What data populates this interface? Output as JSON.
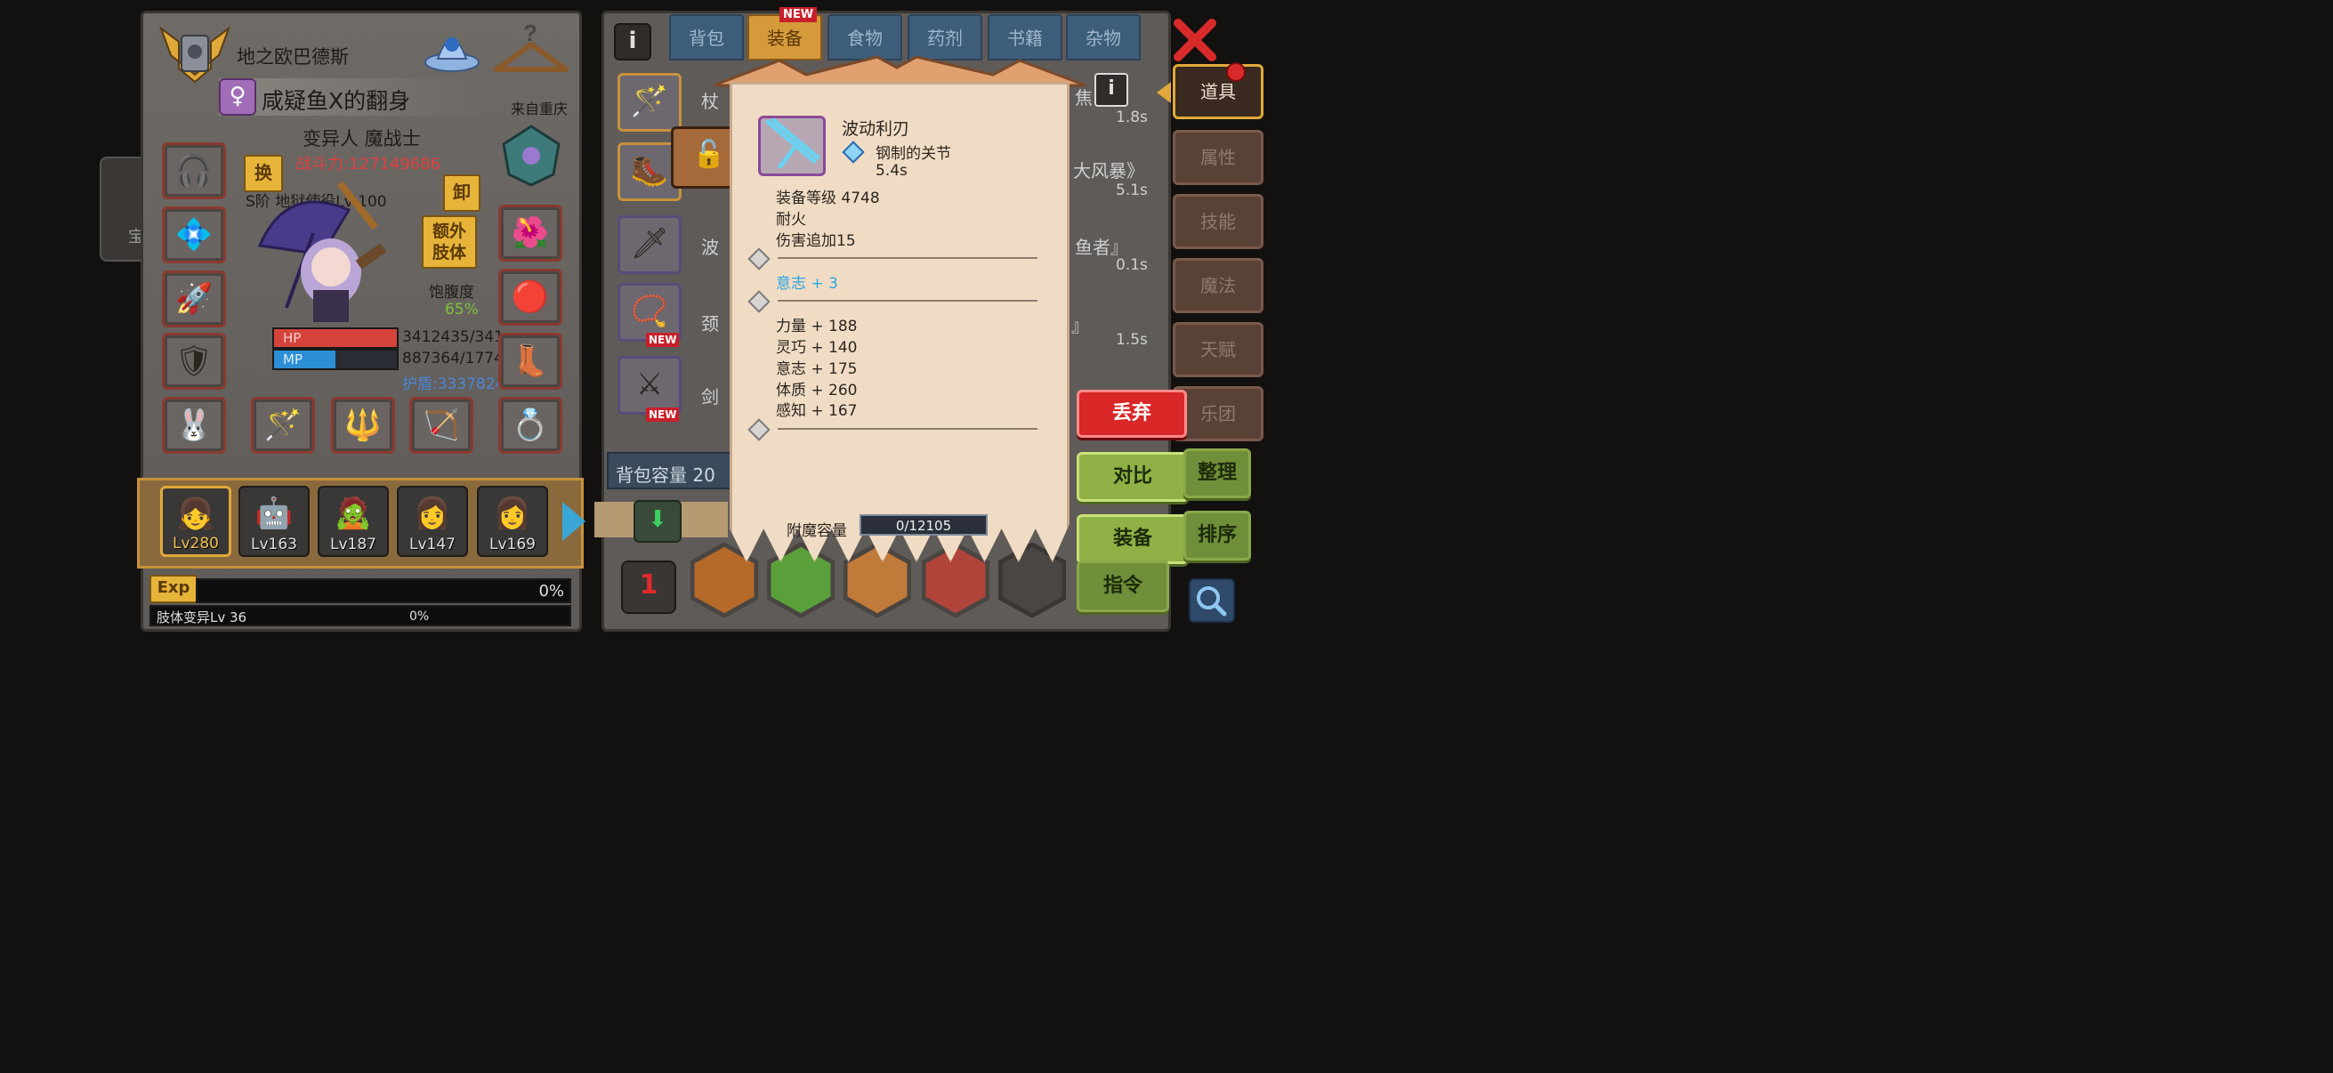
{
  "character": {
    "realm_title": "地之欧巴德斯",
    "player_name": "咸疑鱼X的翻身",
    "location": "来自重庆",
    "class_name": "变异人 魔战士",
    "combat_power": "战斗力:127149686",
    "swap_label": "换",
    "unequip_label": "卸",
    "extra_limb_label": "额外\n肢体",
    "gear_title": "S阶 地狱使役Lv 100",
    "satiety_label": "饱腹度",
    "satiety_value": "65%",
    "hp_label": "HP",
    "hp_value": "3412435/341",
    "hp_fill": 1.0,
    "mp_label": "MP",
    "mp_value": "887364/1774",
    "mp_fill": 0.5,
    "shield_value": "护盾:3337824",
    "exp_label": "Exp",
    "exp_percent": "0%",
    "limb_mutation": "肢体变异Lv 36",
    "limb_percent": "0%"
  },
  "party": [
    {
      "level": "Lv280"
    },
    {
      "level": "Lv163"
    },
    {
      "level": "Lv187"
    },
    {
      "level": "Lv147"
    },
    {
      "level": "Lv169"
    }
  ],
  "inventory": {
    "tabs": [
      "背包",
      "装备",
      "食物",
      "药剂",
      "书籍",
      "杂物"
    ],
    "active_tab": "装备",
    "new_badge": "NEW",
    "rows": [
      {
        "left_text": "杖",
        "right_text": "焦",
        "time": "1.8s",
        "new": ""
      },
      {
        "left_text": "",
        "right_text": "大风暴》",
        "time": "5.1s",
        "new": ""
      },
      {
        "left_text": "波",
        "right_text": "鱼者』",
        "time": "0.1s",
        "new": ""
      },
      {
        "left_text": "颈",
        "right_text": "』",
        "time": "1.5s",
        "new": "NEW"
      },
      {
        "left_text": "剑",
        "right_text": "",
        "time": "",
        "new": "NEW"
      }
    ],
    "capacity_label": "背包容量 20"
  },
  "tooltip": {
    "item_name": "波动利刃",
    "socket_name": "钢制的关节",
    "attack_speed": "5.4s",
    "equip_level": "装备等级 4748",
    "trait1": "耐火",
    "trait2": "伤害追加15",
    "bonus_stat": "意志 + 3",
    "stats": [
      "力量 + 188",
      "灵巧 + 140",
      "意志 + 175",
      "体质 + 260",
      "感知 + 167"
    ],
    "enchant_label": "附魔容量",
    "enchant_value": "0/12105",
    "enchant_fill": 0.0
  },
  "side_tabs": [
    "道具",
    "属性",
    "技能",
    "魔法",
    "天赋",
    "乐团"
  ],
  "actions": {
    "discard": "丢弃",
    "compare": "对比",
    "equip": "装备",
    "organize": "整理",
    "sort": "排序",
    "command": "指令"
  },
  "left_edge_label": "宝",
  "colors": {
    "hp": "#d6433a",
    "mp": "#2c8fd6",
    "combat_power": "#e04040",
    "satiety": "#7ec23a",
    "shield": "#4a86d6",
    "bonus_stat": "#2aa6e0",
    "discard": "#d92626",
    "new_badge": "#c8202a"
  }
}
